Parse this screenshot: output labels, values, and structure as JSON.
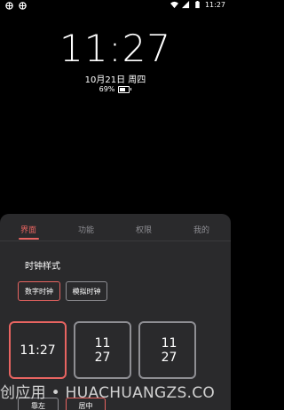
{
  "status_bar": {
    "time": "11:27",
    "left_icons": [
      "notification-icon",
      "notification-icon"
    ],
    "right_icons": [
      "wifi-icon",
      "signal-icon",
      "battery-icon"
    ]
  },
  "lockscreen": {
    "time": "11:27",
    "date": "10月21日 周四",
    "battery_percent": "69%",
    "battery_level": 0.69
  },
  "panel": {
    "tabs": [
      {
        "label": "界面",
        "active": true
      },
      {
        "label": "功能",
        "active": false
      },
      {
        "label": "权限",
        "active": false
      },
      {
        "label": "我的",
        "active": false
      }
    ],
    "section_title": "时钟样式",
    "style_options": [
      {
        "label": "数字时钟",
        "selected": true
      },
      {
        "label": "模拟时钟",
        "selected": false
      }
    ],
    "clock_cards": [
      {
        "line1": "11:27",
        "line2": "",
        "selected": true
      },
      {
        "line1": "11",
        "line2": "27",
        "selected": false
      },
      {
        "line1": "11",
        "line2": "27",
        "selected": false
      }
    ],
    "align_options": [
      {
        "label": "靠左",
        "selected": false
      },
      {
        "label": "居中",
        "selected": true
      }
    ]
  },
  "watermark": "创应用 • HUACHUANGZS.CO",
  "colors": {
    "accent": "#e86461",
    "panel_bg": "#2a2a2c",
    "muted": "#8e8e93"
  }
}
